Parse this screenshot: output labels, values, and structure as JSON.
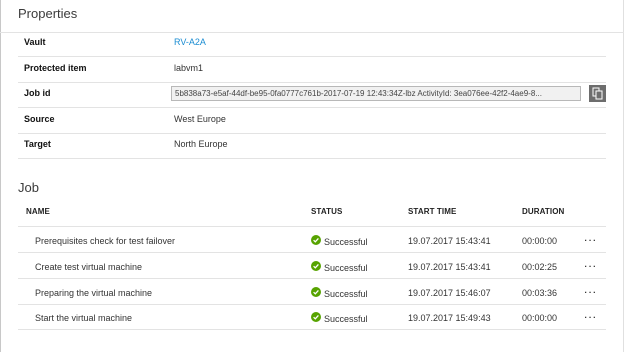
{
  "properties": {
    "title": "Properties",
    "vault": {
      "label": "Vault",
      "value": "RV-A2A"
    },
    "protected_item": {
      "label": "Protected item",
      "value": "labvm1"
    },
    "job_id": {
      "label": "Job id",
      "value": "5b838a73-e5af-44df-be95-0fa0777c761b-2017-07-19 12:43:34Z-lbz ActivityId: 3ea076ee-42f2-4ae9-8..."
    },
    "source": {
      "label": "Source",
      "value": "West Europe"
    },
    "target": {
      "label": "Target",
      "value": "North Europe"
    }
  },
  "job": {
    "title": "Job",
    "columns": {
      "name": "NAME",
      "status": "STATUS",
      "start_time": "START TIME",
      "duration": "DURATION"
    },
    "rows": [
      {
        "name": "Prerequisites check for test failover",
        "status": "Successful",
        "start_time": "19.07.2017 15:43:41",
        "duration": "00:00:00",
        "menu": "..."
      },
      {
        "name": "Create test virtual machine",
        "status": "Successful",
        "start_time": "19.07.2017 15:43:41",
        "duration": "00:02:25",
        "menu": "..."
      },
      {
        "name": "Preparing the virtual machine",
        "status": "Successful",
        "start_time": "19.07.2017 15:46:07",
        "duration": "00:03:36",
        "menu": "..."
      },
      {
        "name": "Start the virtual machine",
        "status": "Successful",
        "start_time": "19.07.2017 15:49:43",
        "duration": "00:00:00",
        "menu": "..."
      }
    ]
  },
  "icons": {
    "status": "check-circle-icon",
    "copy": "copy-icon"
  },
  "colors": {
    "link": "#1a8cd2",
    "success": "#57a300",
    "copy_button": "#6d6d6d"
  }
}
